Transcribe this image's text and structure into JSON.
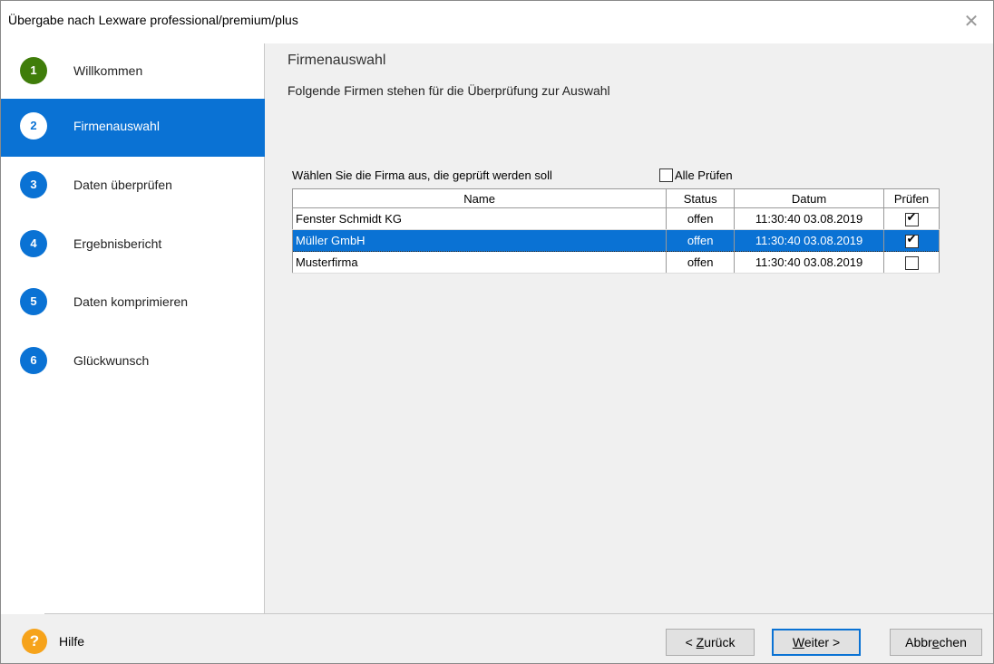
{
  "window": {
    "title": "Übergabe nach Lexware professional/premium/plus",
    "close_glyph": "✕"
  },
  "sidebar": {
    "steps": [
      {
        "num": "1",
        "label": "Willkommen",
        "state": "done"
      },
      {
        "num": "2",
        "label": "Firmenauswahl",
        "state": "active"
      },
      {
        "num": "3",
        "label": "Daten überprüfen",
        "state": "pending"
      },
      {
        "num": "4",
        "label": "Ergebnisbericht",
        "state": "pending"
      },
      {
        "num": "5",
        "label": "Daten komprimieren",
        "state": "pending"
      },
      {
        "num": "6",
        "label": "Glückwunsch",
        "state": "pending"
      }
    ]
  },
  "main": {
    "heading": "Firmenauswahl",
    "subheading": "Folgende Firmen stehen für die Überprüfung zur Auswahl",
    "instruction": "Wählen Sie die Firma aus, die geprüft werden soll",
    "all_check_label": "Alle Prüfen",
    "all_checked": false,
    "columns": [
      "Name",
      "Status",
      "Datum",
      "Prüfen"
    ],
    "rows": [
      {
        "name": "Fenster Schmidt KG",
        "status": "offen",
        "datum": "11:30:40 03.08.2019",
        "checked": true,
        "selected": false
      },
      {
        "name": "Müller GmbH",
        "status": "offen",
        "datum": "11:30:40 03.08.2019",
        "checked": true,
        "selected": true
      },
      {
        "name": "Musterfirma",
        "status": "offen",
        "datum": "11:30:40 03.08.2019",
        "checked": false,
        "selected": false
      }
    ]
  },
  "footer": {
    "help_icon": "?",
    "help_label": "Hilfe",
    "back_pre": "< ",
    "back_key": "Z",
    "back_post": "urück",
    "next_key": "W",
    "next_post": "eiter >",
    "cancel_pre": "Abbr",
    "cancel_key": "e",
    "cancel_post": "chen"
  },
  "colors": {
    "accent": "#0a72d4",
    "done": "#3f7d0a",
    "help": "#f6a31b"
  }
}
